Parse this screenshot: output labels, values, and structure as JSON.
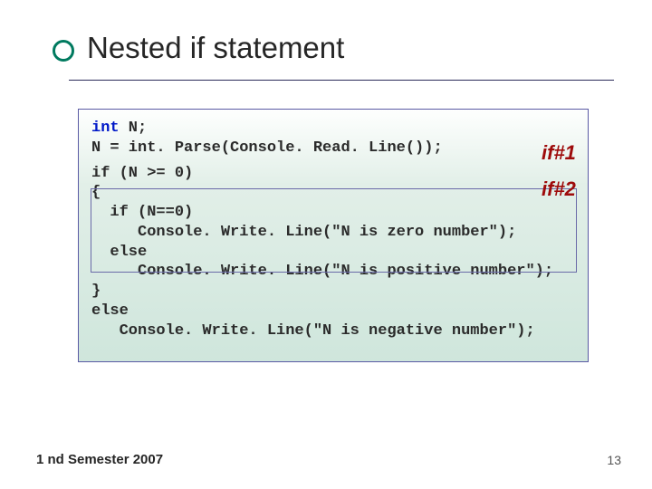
{
  "title": "Nested if statement",
  "code": {
    "l1a": "int",
    "l1b": " N;",
    "l2": "N = int. Parse(Console. Read. Line());",
    "l3": "if (N >= 0)",
    "l4": "{",
    "l5": "  if (N==0)",
    "l6": "     Console. Write. Line(\"N is zero number\");",
    "l7": "  else",
    "l8": "     Console. Write. Line(\"N is positive number\");",
    "l9": "}",
    "l10": "else",
    "l11": "   Console. Write. Line(\"N is negative number\");"
  },
  "labels": {
    "if1": "if#1",
    "if2": "if#2"
  },
  "footer": {
    "left": "1 nd Semester 2007",
    "right": "13"
  }
}
